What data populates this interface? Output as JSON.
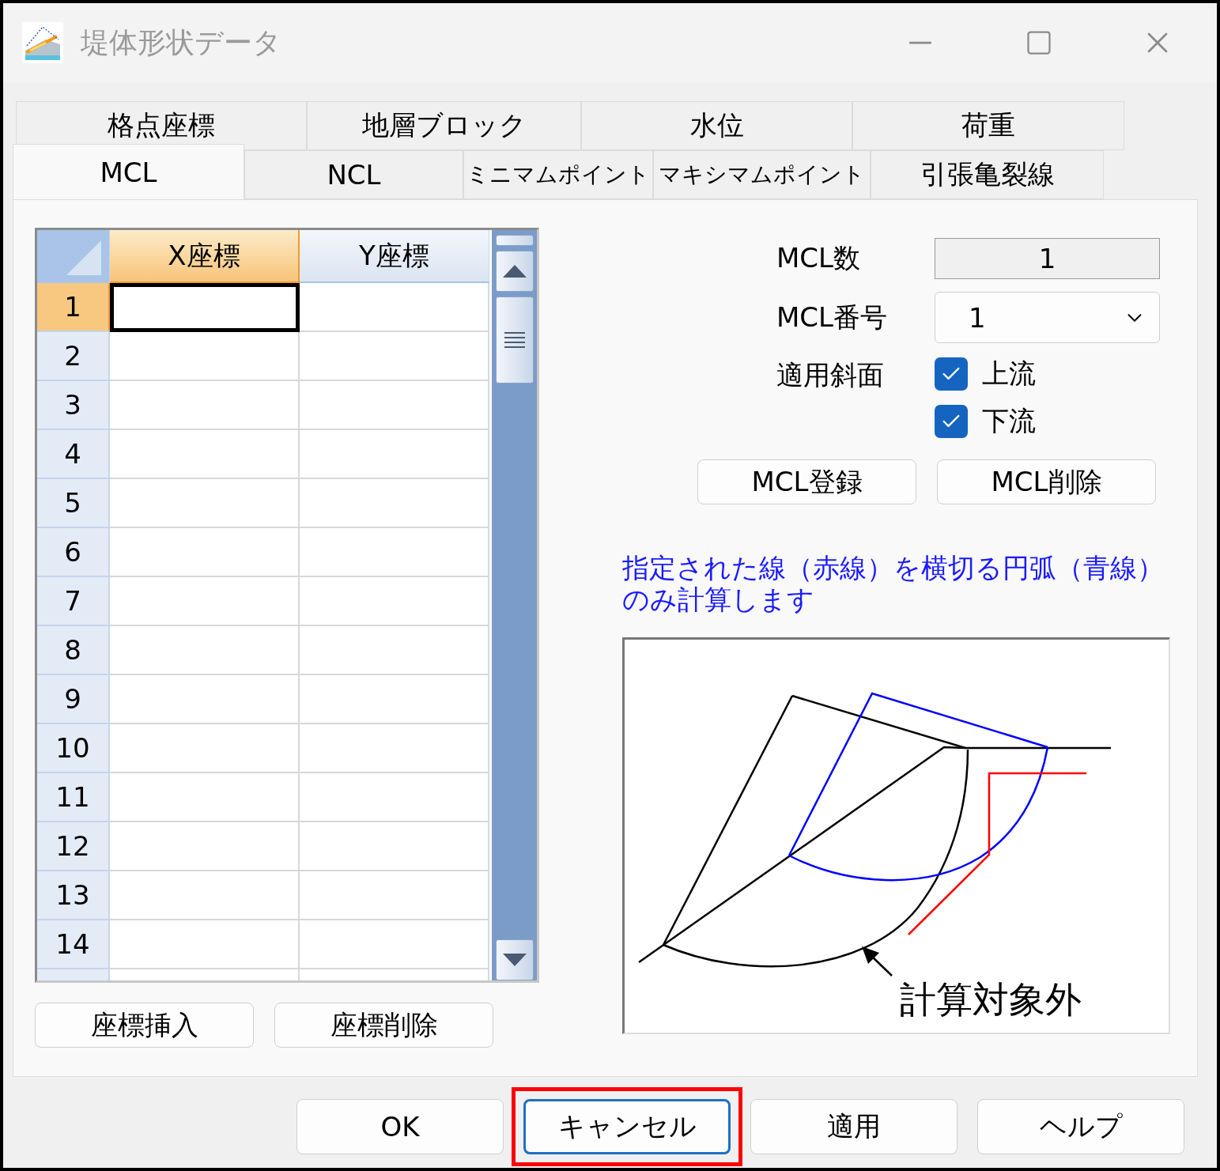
{
  "window": {
    "title": "堤体形状データ"
  },
  "tab_rows": [
    [
      {
        "label": "格点座標",
        "selected": false
      },
      {
        "label": "地層ブロック",
        "selected": false
      },
      {
        "label": "水位",
        "selected": false
      },
      {
        "label": "荷重",
        "selected": false
      }
    ],
    [
      {
        "label": "MCL",
        "selected": true
      },
      {
        "label": "NCL",
        "selected": false
      },
      {
        "label": "ミニマムポイント",
        "selected": false
      },
      {
        "label": "マキシマムポイント",
        "selected": false
      },
      {
        "label": "引張亀裂線",
        "selected": false
      }
    ]
  ],
  "grid": {
    "columns": [
      {
        "label": "X座標",
        "selected": true
      },
      {
        "label": "Y座標",
        "selected": false
      }
    ],
    "rows": [
      {
        "label": "1",
        "selected": true
      },
      {
        "label": "2",
        "selected": false
      },
      {
        "label": "3",
        "selected": false
      },
      {
        "label": "4",
        "selected": false
      },
      {
        "label": "5",
        "selected": false
      },
      {
        "label": "6",
        "selected": false
      },
      {
        "label": "7",
        "selected": false
      },
      {
        "label": "8",
        "selected": false
      },
      {
        "label": "9",
        "selected": false
      },
      {
        "label": "10",
        "selected": false
      },
      {
        "label": "11",
        "selected": false
      },
      {
        "label": "12",
        "selected": false
      },
      {
        "label": "13",
        "selected": false
      },
      {
        "label": "14",
        "selected": false
      }
    ]
  },
  "grid_buttons": [
    "座標挿入",
    "座標削除"
  ],
  "settings": {
    "count": {
      "label": "MCL数",
      "value": "1"
    },
    "number": {
      "label": "MCL番号",
      "value": "1"
    },
    "slopes": {
      "label": "適用斜面",
      "options": [
        {
          "label": "上流",
          "checked": true
        },
        {
          "label": "下流",
          "checked": true
        }
      ]
    }
  },
  "mcl_buttons": [
    "MCL登録",
    "MCL削除"
  ],
  "note_lines": [
    "指定された線（赤線）を横切る円弧（青線）",
    "のみ計算します"
  ],
  "diagram": {
    "label": "計算対象外"
  },
  "buttons": [
    {
      "label": "OK",
      "highlighted": false,
      "focused": false
    },
    {
      "label": "キャンセル",
      "highlighted": true,
      "focused": true
    },
    {
      "label": "適用",
      "highlighted": false,
      "focused": false
    },
    {
      "label": "ヘルプ",
      "highlighted": false,
      "focused": false
    }
  ]
}
